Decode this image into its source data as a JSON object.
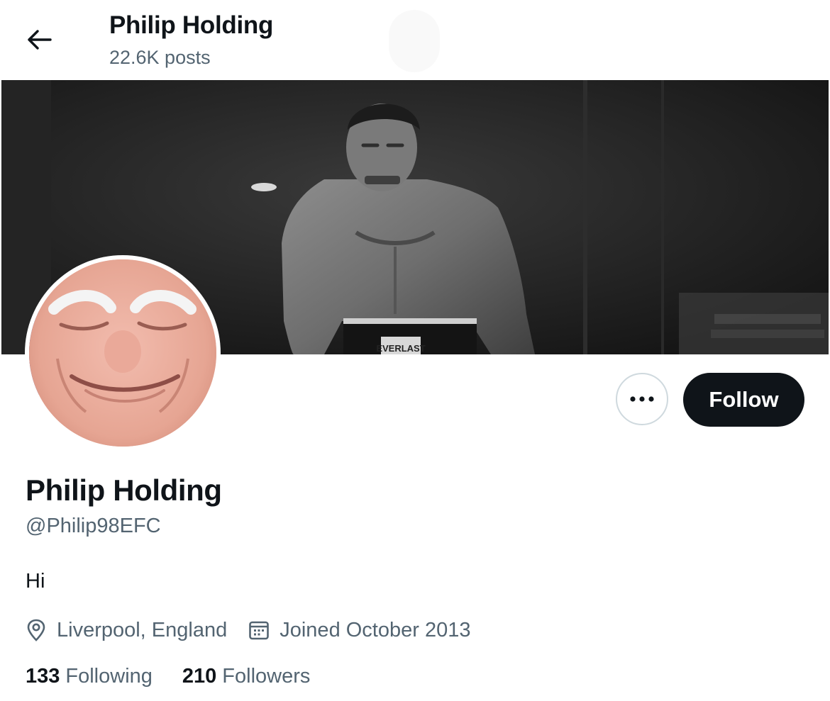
{
  "header": {
    "title": "Philip Holding",
    "posts_count": "22.6K posts",
    "back_icon": "arrow-left-icon"
  },
  "profile": {
    "display_name": "Philip Holding",
    "handle": "@Philip98EFC",
    "bio": "Hi",
    "location": "Liverpool, England",
    "joined": "Joined October 2013",
    "following_count": "133",
    "following_label": "Following",
    "followers_count": "210",
    "followers_label": "Followers"
  },
  "actions": {
    "more_icon": "more-horizontal-icon",
    "follow_label": "Follow"
  },
  "images": {
    "banner": "black-and-white photo of a boxer in a ring wearing EVERLAST trunks",
    "banner_trunks_text": "EVERLAST",
    "avatar": "close-up photo of a grinning face"
  },
  "colors": {
    "text_primary": "#0f1419",
    "text_secondary": "#536471",
    "follow_bg": "#0f1419",
    "border": "#cfd9de"
  }
}
